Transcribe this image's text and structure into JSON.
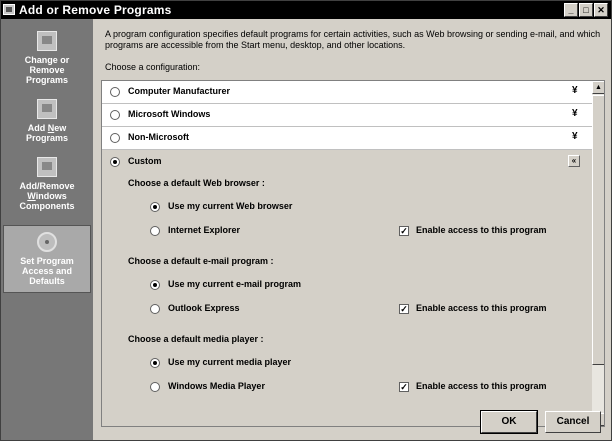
{
  "window": {
    "title": "Add or Remove Programs"
  },
  "sidebar": {
    "items": [
      {
        "line1": "Change or",
        "line2": "Remove",
        "line3": "Programs",
        "icon": "change-remove-icon"
      },
      {
        "line1": "Add ",
        "line1_u": "N",
        "line1_rest": "ew",
        "line2": "Programs",
        "icon": "add-programs-icon"
      },
      {
        "line1": "Add/Remove",
        "line2_u": "W",
        "line2_rest": "indows",
        "line3": "Components",
        "icon": "windows-components-icon"
      },
      {
        "line1": "Set Program",
        "line2": "Access and",
        "line3": "Defaults",
        "icon": "set-program-access-icon",
        "active": true
      }
    ]
  },
  "main": {
    "intro": "A program configuration specifies default programs for certain activities, such as Web browsing or sending e-mail, and which programs are accessible from the Start menu, desktop, and other locations.",
    "choose_label": "Choose a configuration:",
    "configurations": [
      {
        "label": "Computer Manufacturer",
        "selected": false
      },
      {
        "label": "Microsoft Windows",
        "selected": false
      },
      {
        "label": "Non-Microsoft",
        "selected": false
      },
      {
        "label": "Custom",
        "selected": true
      }
    ],
    "custom": {
      "sections": [
        {
          "heading": "Choose a default Web browser :",
          "current_option": "Use my current Web browser",
          "alt_option": "Internet Explorer",
          "enable_label": "Enable access to this program",
          "enable_checked": true
        },
        {
          "heading": "Choose a default e-mail program :",
          "current_option": "Use my current e-mail program",
          "alt_option": "Outlook Express",
          "enable_label": "Enable access to this program",
          "enable_checked": true
        },
        {
          "heading": "Choose a default media player :",
          "current_option": "Use my current media player",
          "alt_option": "Windows Media Player",
          "enable_label": "Enable access to this program",
          "enable_checked": true
        }
      ]
    },
    "buttons": {
      "ok": "OK",
      "cancel": "Cancel"
    }
  },
  "glyphs": {
    "expand": "¥",
    "collapse": "«",
    "check": "✓",
    "minimize": "_",
    "maximize": "□",
    "close": "✕",
    "scroll_up": "▲",
    "scroll_down": "▼"
  },
  "colors": {
    "titlebar": "#000000",
    "sidebar": "#777777",
    "dialog_face": "#d4d0c8"
  }
}
